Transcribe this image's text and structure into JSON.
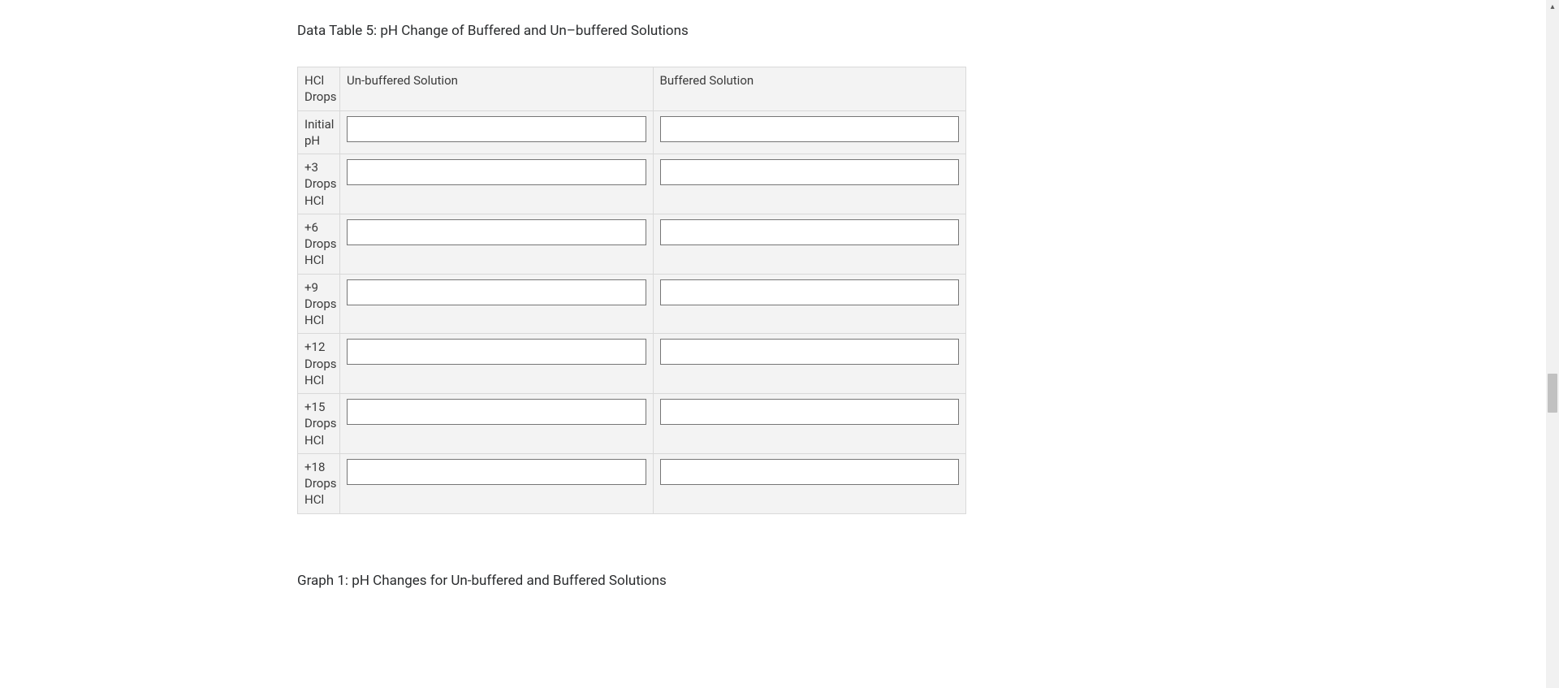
{
  "title": "Data Table 5: pH Change of Buffered and Un–buffered Solutions",
  "graph_title": "Graph 1: pH Changes for Un-buffered and Buffered Solutions",
  "columns": {
    "c0": "HCl Drops",
    "c1": "Un-buffered Solution",
    "c2": "Buffered Solution"
  },
  "rows": [
    {
      "label": "Initial pH",
      "unbuffered": "",
      "buffered": ""
    },
    {
      "label": "+3 Drops HCl",
      "unbuffered": "",
      "buffered": ""
    },
    {
      "label": "+6 Drops HCl",
      "unbuffered": "",
      "buffered": ""
    },
    {
      "label": "+9 Drops HCl",
      "unbuffered": "",
      "buffered": ""
    },
    {
      "label": "+12 Drops HCl",
      "unbuffered": "",
      "buffered": ""
    },
    {
      "label": "+15 Drops HCl",
      "unbuffered": "",
      "buffered": ""
    },
    {
      "label": "+18 Drops HCl",
      "unbuffered": "",
      "buffered": ""
    }
  ]
}
